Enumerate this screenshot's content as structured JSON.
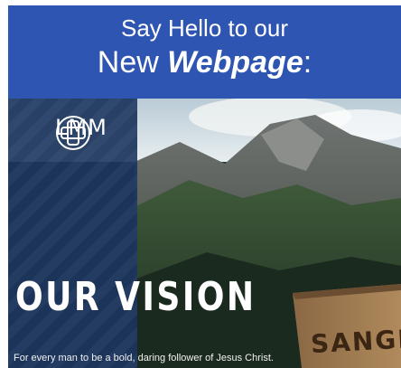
{
  "banner": {
    "line1": "Say Hello to our",
    "line2_prefix": "New",
    "line2_emphasis": "Webpage",
    "line2_suffix": ":"
  },
  "hero": {
    "brand": "LMM",
    "heading": "OUR VISION",
    "tagline": "For every man to be a bold, daring follower of Jesus Christ.",
    "sign_text": "SANGR"
  },
  "colors": {
    "banner_bg": "#2f55b2",
    "panel_bg": "#1c345c",
    "text": "#ffffff"
  }
}
